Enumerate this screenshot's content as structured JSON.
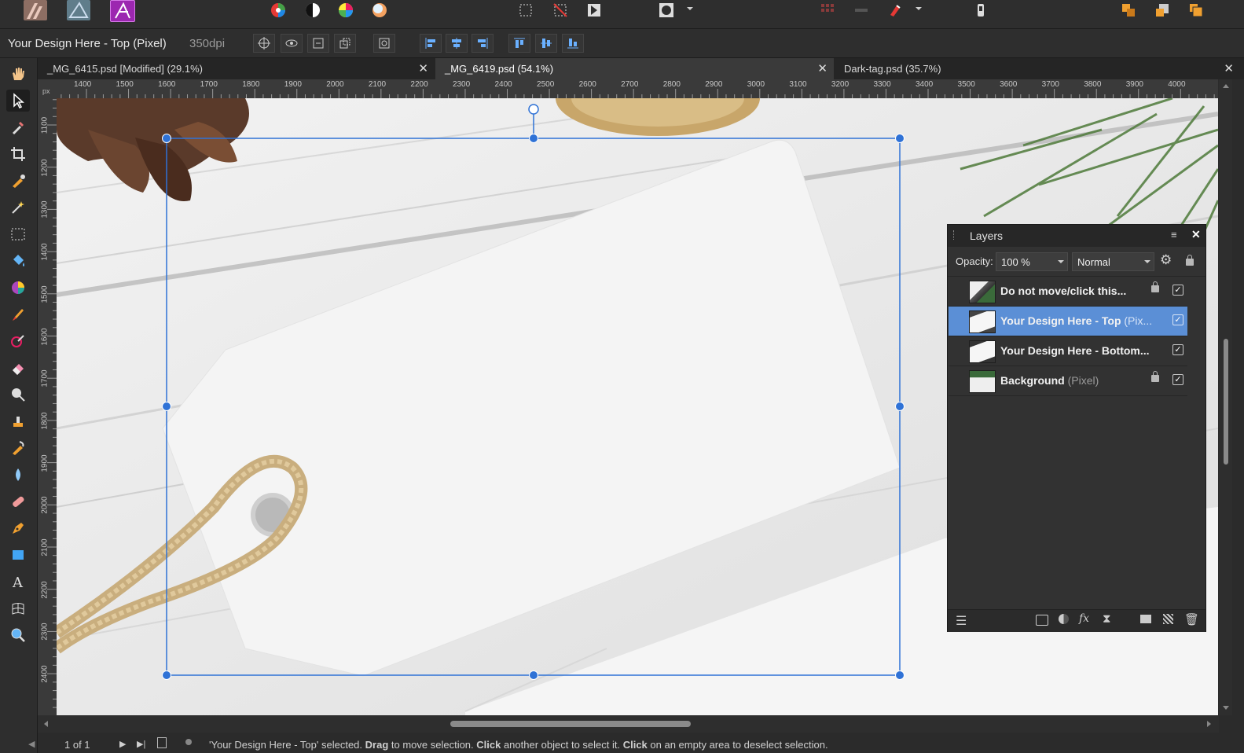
{
  "context": {
    "layer_title": "Your Design Here - Top (Pixel)",
    "dpi": "350dpi"
  },
  "tabs": [
    {
      "label": "_MG_6415.psd [Modified] (29.1%)",
      "close": "✕"
    },
    {
      "label": "_MG_6419.psd (54.1%)",
      "close": "✕"
    },
    {
      "label": "Dark-tag.psd (35.7%)",
      "close": "✕"
    }
  ],
  "ruler": {
    "unit": "px",
    "h_ticks": [
      "1400",
      "1500",
      "1600",
      "1700",
      "1800",
      "1900",
      "2000",
      "2100",
      "2200",
      "2300",
      "2400",
      "2500",
      "2600",
      "2700",
      "2800",
      "2900",
      "3000",
      "3100",
      "3200",
      "3300",
      "3400",
      "3500",
      "3600",
      "3700",
      "3800",
      "3900",
      "4000"
    ],
    "v_ticks": [
      "1100",
      "1200",
      "1300",
      "1400",
      "1500",
      "1600",
      "1700",
      "1800",
      "1900",
      "2000",
      "2100",
      "2200",
      "2300",
      "2400"
    ]
  },
  "layers_panel": {
    "title": "Layers",
    "opacity_label": "Opacity:",
    "opacity_value": "100 %",
    "blend_mode": "Normal",
    "layers": [
      {
        "name": "Do not move/click this...",
        "type": "",
        "locked": true,
        "visible": true,
        "selected": false
      },
      {
        "name": "Your Design Here - Top",
        "type": "(Pix...",
        "locked": false,
        "visible": true,
        "selected": true
      },
      {
        "name": "Your Design Here - Bottom...",
        "type": "",
        "locked": false,
        "visible": true,
        "selected": false
      },
      {
        "name": "Background",
        "type": "(Pixel)",
        "locked": true,
        "visible": true,
        "selected": false
      }
    ]
  },
  "status": {
    "page": "1 of 1",
    "message_parts": [
      "'Your Design Here - Top' selected. ",
      "Drag",
      " to move selection. ",
      "Click",
      " another object to select it. ",
      "Click",
      " on an empty area to deselect selection."
    ]
  },
  "colors": {
    "selection_accent": "#2f72d6",
    "selected_layer": "#5b8fd6",
    "panel_bg": "#323232"
  }
}
